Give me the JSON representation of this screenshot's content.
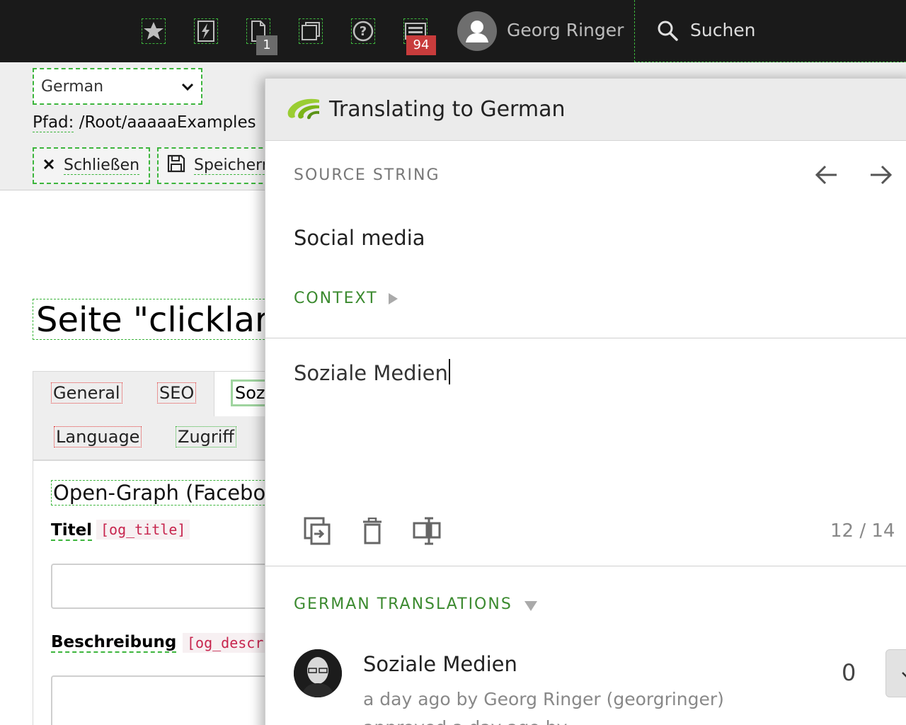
{
  "topbar": {
    "icons": [
      "star-icon",
      "lightning-icon",
      "document-icon",
      "window-icon",
      "help-icon",
      "system-info-icon"
    ],
    "opendocs_count": "1",
    "system_info_count": "94",
    "user_name": "Georg Ringer",
    "search_label": "Suchen"
  },
  "docheader": {
    "language_select": "German",
    "path_label": "Pfad:",
    "path_value": "/Root/aaaaaExamples",
    "close_label": "Schließen",
    "save_label": "Speichern"
  },
  "page": {
    "title": "Seite \"clicklarg",
    "tabs": [
      "General",
      "SEO",
      "Soziale Medien",
      "Language",
      "Zugriff"
    ],
    "section_header": "Open-Graph (Facebook)",
    "field_title_label": "Titel",
    "field_title_code": "[og_title]",
    "field_desc_label": "Beschreibung",
    "field_desc_code": "[og_description]"
  },
  "panel": {
    "title": "Translating to German",
    "source_label": "SOURCE STRING",
    "source_text": "Social media",
    "context_label": "CONTEXT",
    "translation_value": "Soziale Medien",
    "counter": "12 / 14",
    "translations_label": "GERMAN TRANSLATIONS",
    "suggestion": {
      "text": "Soziale Medien",
      "meta": "a day ago by Georg Ringer (georgringer)",
      "meta2": "approved a day ago by",
      "votes": "0"
    }
  },
  "colors": {
    "topbar_bg": "#1a1a1a",
    "badge_red": "#c83c3c",
    "accent_green": "#3b8a2f",
    "focus_dash": "#3db53d"
  }
}
